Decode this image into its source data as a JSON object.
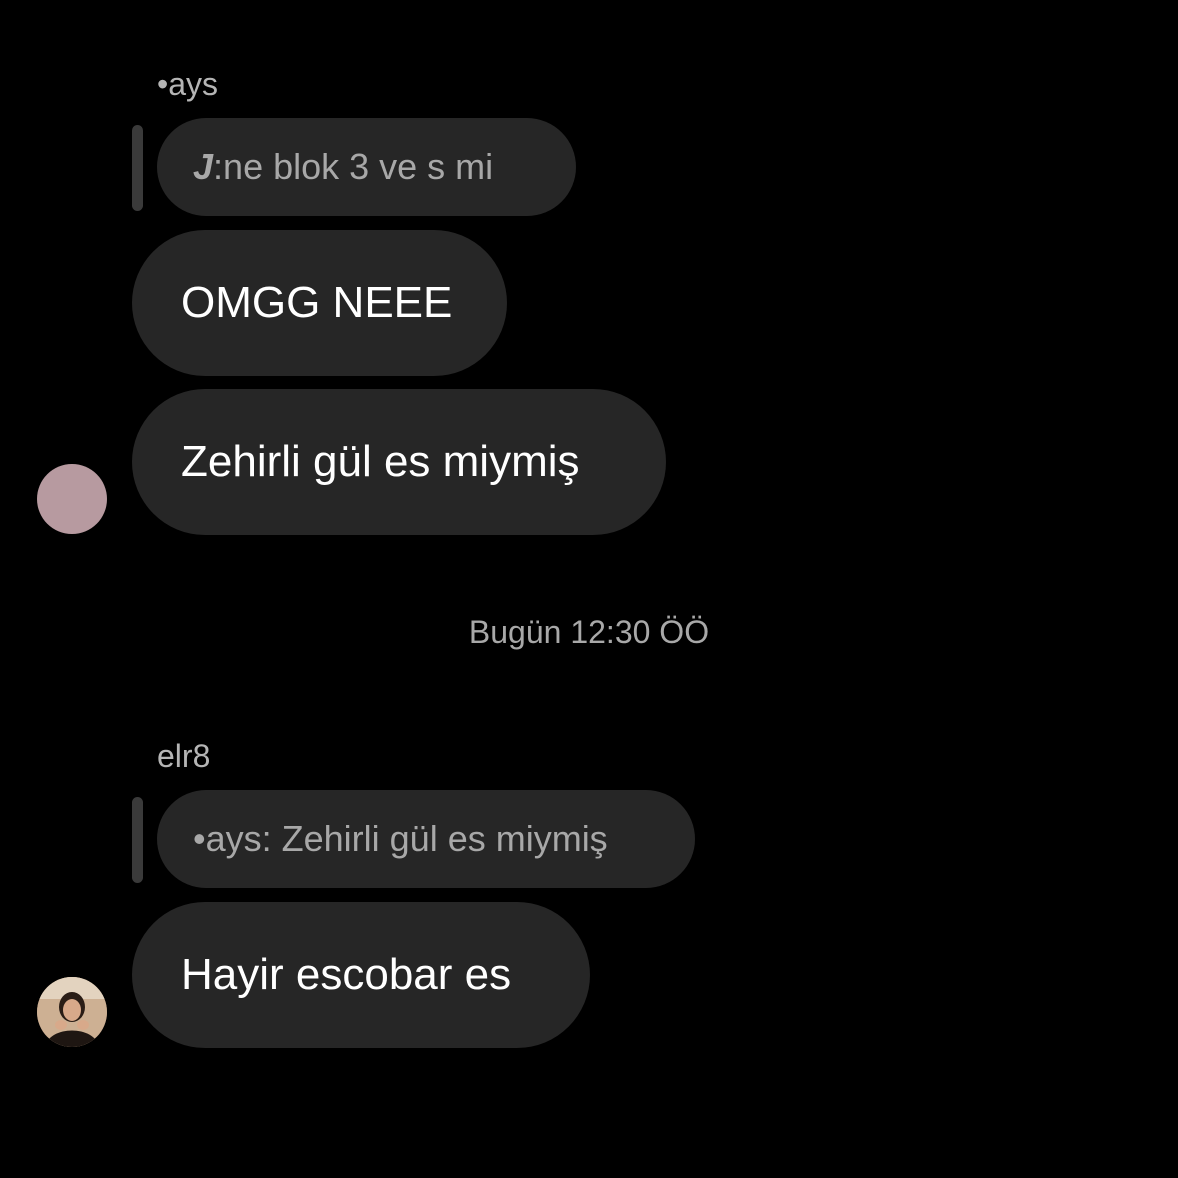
{
  "thread": {
    "group1": {
      "sender": "•ays",
      "reply": {
        "author": "J",
        "separator": ":",
        "text": " ne blok 3 ve s mi"
      },
      "messages": [
        "OMGG NEEE",
        "Zehirli gül es miymiş"
      ],
      "avatar_color": "#b79aa0"
    },
    "timestamp": "Bugün 12:30 ÖÖ",
    "group2": {
      "sender": "elr8",
      "reply": {
        "text": "•ays: Zehirli gül es miymiş"
      },
      "messages": [
        "Hayir escobar es"
      ],
      "avatar": "profile-photo"
    }
  },
  "colors": {
    "background": "#000000",
    "bubble": "#262626",
    "reply_bubble": "#262626",
    "reply_bar": "#3a3a3a",
    "primary_text": "#ffffff",
    "secondary_text": "#a8a8a8"
  }
}
